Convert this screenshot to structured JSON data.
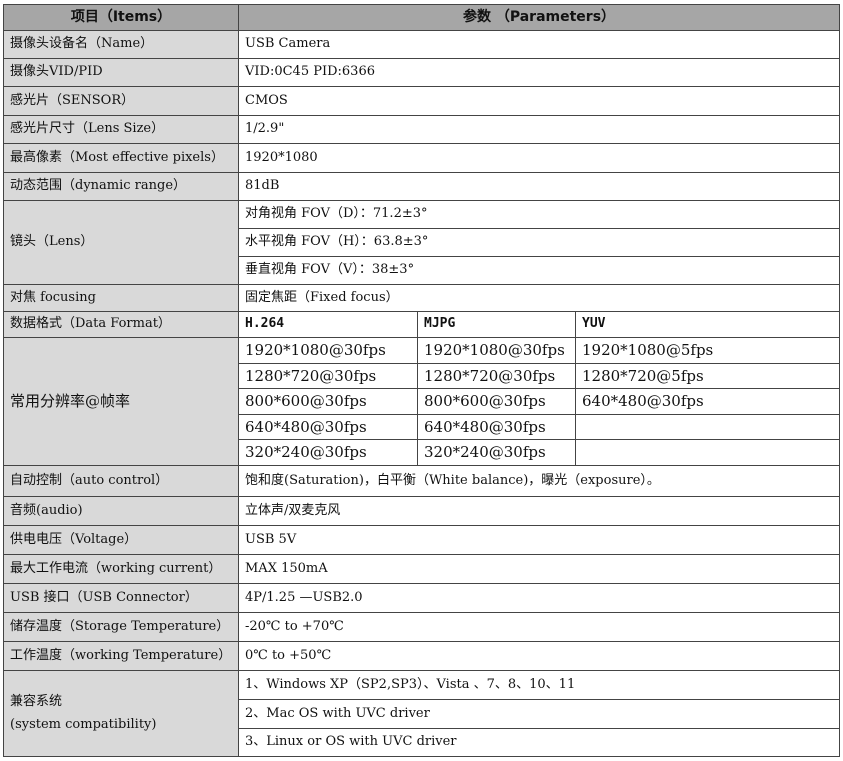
{
  "header": {
    "items": "项目（Items）",
    "params": "参数  （Parameters）"
  },
  "rows": {
    "device_name": {
      "label": "摄像头设备名（Name）",
      "value": "USB Camera"
    },
    "vid_pid": {
      "label": "摄像头VID/PID",
      "value": "VID:0C45  PID:6366"
    },
    "sensor": {
      "label": "感光片（SENSOR）",
      "value": "CMOS"
    },
    "lens_size": {
      "label": "感光片尺寸（Lens Size）",
      "value": "1/2.9\""
    },
    "pixels": {
      "label": "最高像素（Most effective pixels）",
      "value": "1920*1080"
    },
    "dynamic_range": {
      "label": "动态范围（dynamic  range）",
      "value": "81dB"
    },
    "lens": {
      "label": "镜头（Lens）",
      "values": [
        "对角视角 FOV（D）：71.2±3°",
        "水平视角 FOV（H）：63.8±3°",
        "垂直视角 FOV（V）：38±3°"
      ]
    },
    "focusing": {
      "label": "对焦 focusing",
      "value": "固定焦距（Fixed focus）"
    },
    "data_format": {
      "label": "数据格式（Data Format）",
      "formats": [
        "H.264",
        "MJPG",
        "YUV"
      ]
    },
    "resolution": {
      "label": "常用分辨率@帧率",
      "h264": [
        "1920*1080@30fps",
        "1280*720@30fps",
        "800*600@30fps",
        "640*480@30fps",
        "320*240@30fps"
      ],
      "mjpg": [
        "1920*1080@30fps",
        "1280*720@30fps",
        "800*600@30fps",
        "640*480@30fps",
        "320*240@30fps"
      ],
      "yuv": [
        "1920*1080@5fps",
        "1280*720@5fps",
        "640*480@30fps",
        "",
        ""
      ]
    },
    "auto_control": {
      "label": "自动控制（auto control）",
      "value": "饱和度(Saturation)，白平衡（White balance)，曝光（exposure）。"
    },
    "audio": {
      "label": "音频(audio)",
      "value": "立体声/双麦克风"
    },
    "voltage": {
      "label": "供电电压（Voltage）",
      "value": "USB 5V"
    },
    "current": {
      "label": "最大工作电流（working current）",
      "value": "MAX 150mA"
    },
    "usb": {
      "label": "USB 接口（USB Connector）",
      "value": "4P/1.25 —USB2.0"
    },
    "storage_temp": {
      "label": "储存温度（Storage Temperature）",
      "value": "-20℃ to +70℃"
    },
    "working_temp": {
      "label": "工作温度（working Temperature）",
      "value": "0℃ to +50℃"
    },
    "compat": {
      "label_1": "兼容系统",
      "label_2": "(system compatibility)",
      "values": [
        "1、Windows XP（SP2,SP3）、Vista 、7、8、10、11",
        "2、Mac OS with UVC driver",
        "3、Linux or OS with UVC driver"
      ]
    }
  }
}
